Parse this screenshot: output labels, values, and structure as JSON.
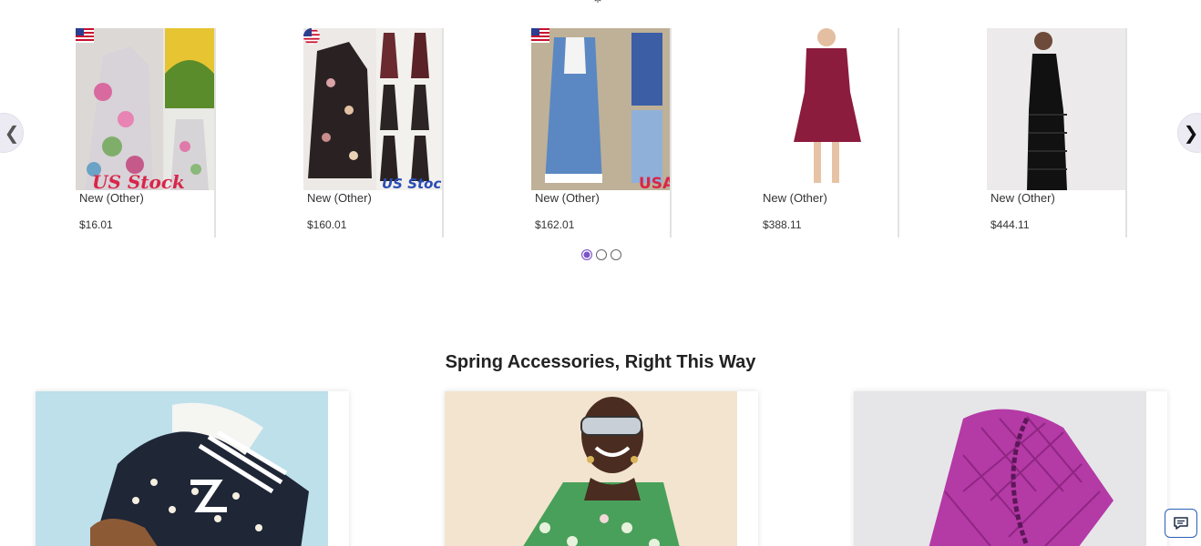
{
  "header": {
    "top_glyph": "*"
  },
  "carousel": {
    "prev_label": "❮",
    "next_label": "❯",
    "items": [
      {
        "condition": "New (Other)",
        "price": "$16.01",
        "badge": "US Stock"
      },
      {
        "condition": "New (Other)",
        "price": "$160.01",
        "badge": "US Stock"
      },
      {
        "condition": "New (Other)",
        "price": "$162.01",
        "badge": "USA"
      },
      {
        "condition": "New (Other)",
        "price": "$388.11"
      },
      {
        "condition": "New (Other)",
        "price": "$444.11"
      }
    ],
    "pages": 3,
    "active_page": 1
  },
  "accessories": {
    "title": "Spring Accessories, Right This Way",
    "tiles": [
      "sneaker",
      "green-floral-top",
      "purple-quilted-bag"
    ]
  },
  "colors": {
    "accent": "#7b54c7",
    "chat_border": "#2b5fb3"
  }
}
